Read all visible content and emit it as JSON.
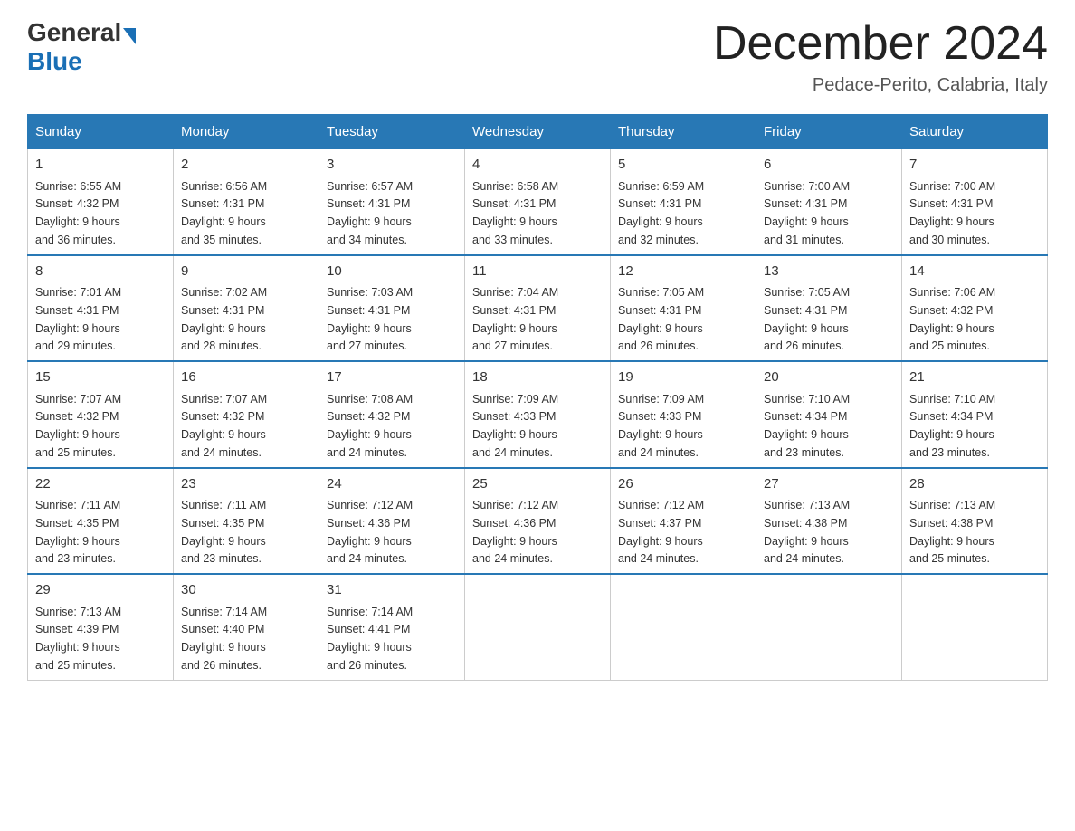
{
  "logo": {
    "general": "General",
    "blue": "Blue"
  },
  "header": {
    "month_year": "December 2024",
    "location": "Pedace-Perito, Calabria, Italy"
  },
  "days_of_week": [
    "Sunday",
    "Monday",
    "Tuesday",
    "Wednesday",
    "Thursday",
    "Friday",
    "Saturday"
  ],
  "weeks": [
    [
      {
        "day": "1",
        "sunrise": "6:55 AM",
        "sunset": "4:32 PM",
        "daylight": "9 hours and 36 minutes."
      },
      {
        "day": "2",
        "sunrise": "6:56 AM",
        "sunset": "4:31 PM",
        "daylight": "9 hours and 35 minutes."
      },
      {
        "day": "3",
        "sunrise": "6:57 AM",
        "sunset": "4:31 PM",
        "daylight": "9 hours and 34 minutes."
      },
      {
        "day": "4",
        "sunrise": "6:58 AM",
        "sunset": "4:31 PM",
        "daylight": "9 hours and 33 minutes."
      },
      {
        "day": "5",
        "sunrise": "6:59 AM",
        "sunset": "4:31 PM",
        "daylight": "9 hours and 32 minutes."
      },
      {
        "day": "6",
        "sunrise": "7:00 AM",
        "sunset": "4:31 PM",
        "daylight": "9 hours and 31 minutes."
      },
      {
        "day": "7",
        "sunrise": "7:00 AM",
        "sunset": "4:31 PM",
        "daylight": "9 hours and 30 minutes."
      }
    ],
    [
      {
        "day": "8",
        "sunrise": "7:01 AM",
        "sunset": "4:31 PM",
        "daylight": "9 hours and 29 minutes."
      },
      {
        "day": "9",
        "sunrise": "7:02 AM",
        "sunset": "4:31 PM",
        "daylight": "9 hours and 28 minutes."
      },
      {
        "day": "10",
        "sunrise": "7:03 AM",
        "sunset": "4:31 PM",
        "daylight": "9 hours and 27 minutes."
      },
      {
        "day": "11",
        "sunrise": "7:04 AM",
        "sunset": "4:31 PM",
        "daylight": "9 hours and 27 minutes."
      },
      {
        "day": "12",
        "sunrise": "7:05 AM",
        "sunset": "4:31 PM",
        "daylight": "9 hours and 26 minutes."
      },
      {
        "day": "13",
        "sunrise": "7:05 AM",
        "sunset": "4:31 PM",
        "daylight": "9 hours and 26 minutes."
      },
      {
        "day": "14",
        "sunrise": "7:06 AM",
        "sunset": "4:32 PM",
        "daylight": "9 hours and 25 minutes."
      }
    ],
    [
      {
        "day": "15",
        "sunrise": "7:07 AM",
        "sunset": "4:32 PM",
        "daylight": "9 hours and 25 minutes."
      },
      {
        "day": "16",
        "sunrise": "7:07 AM",
        "sunset": "4:32 PM",
        "daylight": "9 hours and 24 minutes."
      },
      {
        "day": "17",
        "sunrise": "7:08 AM",
        "sunset": "4:32 PM",
        "daylight": "9 hours and 24 minutes."
      },
      {
        "day": "18",
        "sunrise": "7:09 AM",
        "sunset": "4:33 PM",
        "daylight": "9 hours and 24 minutes."
      },
      {
        "day": "19",
        "sunrise": "7:09 AM",
        "sunset": "4:33 PM",
        "daylight": "9 hours and 24 minutes."
      },
      {
        "day": "20",
        "sunrise": "7:10 AM",
        "sunset": "4:34 PM",
        "daylight": "9 hours and 23 minutes."
      },
      {
        "day": "21",
        "sunrise": "7:10 AM",
        "sunset": "4:34 PM",
        "daylight": "9 hours and 23 minutes."
      }
    ],
    [
      {
        "day": "22",
        "sunrise": "7:11 AM",
        "sunset": "4:35 PM",
        "daylight": "9 hours and 23 minutes."
      },
      {
        "day": "23",
        "sunrise": "7:11 AM",
        "sunset": "4:35 PM",
        "daylight": "9 hours and 23 minutes."
      },
      {
        "day": "24",
        "sunrise": "7:12 AM",
        "sunset": "4:36 PM",
        "daylight": "9 hours and 24 minutes."
      },
      {
        "day": "25",
        "sunrise": "7:12 AM",
        "sunset": "4:36 PM",
        "daylight": "9 hours and 24 minutes."
      },
      {
        "day": "26",
        "sunrise": "7:12 AM",
        "sunset": "4:37 PM",
        "daylight": "9 hours and 24 minutes."
      },
      {
        "day": "27",
        "sunrise": "7:13 AM",
        "sunset": "4:38 PM",
        "daylight": "9 hours and 24 minutes."
      },
      {
        "day": "28",
        "sunrise": "7:13 AM",
        "sunset": "4:38 PM",
        "daylight": "9 hours and 25 minutes."
      }
    ],
    [
      {
        "day": "29",
        "sunrise": "7:13 AM",
        "sunset": "4:39 PM",
        "daylight": "9 hours and 25 minutes."
      },
      {
        "day": "30",
        "sunrise": "7:14 AM",
        "sunset": "4:40 PM",
        "daylight": "9 hours and 26 minutes."
      },
      {
        "day": "31",
        "sunrise": "7:14 AM",
        "sunset": "4:41 PM",
        "daylight": "9 hours and 26 minutes."
      },
      null,
      null,
      null,
      null
    ]
  ],
  "labels": {
    "sunrise": "Sunrise:",
    "sunset": "Sunset:",
    "daylight": "Daylight:"
  }
}
